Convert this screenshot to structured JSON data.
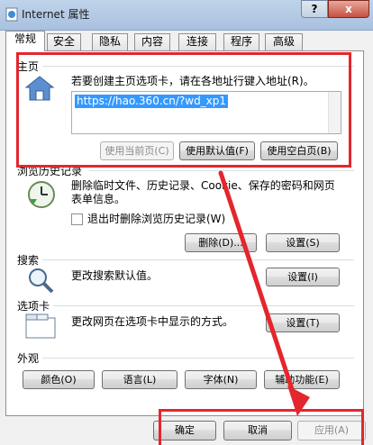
{
  "window": {
    "title": "Internet 属性",
    "help_label": "?",
    "close_label": "x"
  },
  "tabs": [
    "常规",
    "安全",
    "隐私",
    "内容",
    "连接",
    "程序",
    "高级"
  ],
  "active_tab": "常规",
  "home": {
    "section_label": "主页",
    "description": "若要创建主页选项卡，请在各地址行键入地址(R)。",
    "address": "https://hao.360.cn/?wd_xp1",
    "btn_current": "使用当前页(C)",
    "btn_default": "使用默认值(F)",
    "btn_blank": "使用空白页(B)"
  },
  "history": {
    "section_label": "浏览历史记录",
    "description": "删除临时文件、历史记录、Cookie、保存的密码和网页表单信息。",
    "checkbox_label": "退出时删除浏览历史记录(W)",
    "checkbox_checked": false,
    "btn_delete": "删除(D)...",
    "btn_settings": "设置(S)"
  },
  "search": {
    "section_label": "搜索",
    "description": "更改搜索默认值。",
    "btn_settings": "设置(I)"
  },
  "tabs_section": {
    "section_label": "选项卡",
    "description": "更改网页在选项卡中显示的方式。",
    "btn_settings": "设置(T)"
  },
  "appearance": {
    "section_label": "外观",
    "btn_colors": "颜色(O)",
    "btn_languages": "语言(L)",
    "btn_fonts": "字体(N)",
    "btn_accessibility": "辅助功能(E)"
  },
  "dialog_buttons": {
    "ok": "确定",
    "cancel": "取消",
    "apply": "应用(A)"
  },
  "colors": {
    "highlight": "#e4262d",
    "selection": "#3399ff",
    "close_button": "#c75040"
  }
}
